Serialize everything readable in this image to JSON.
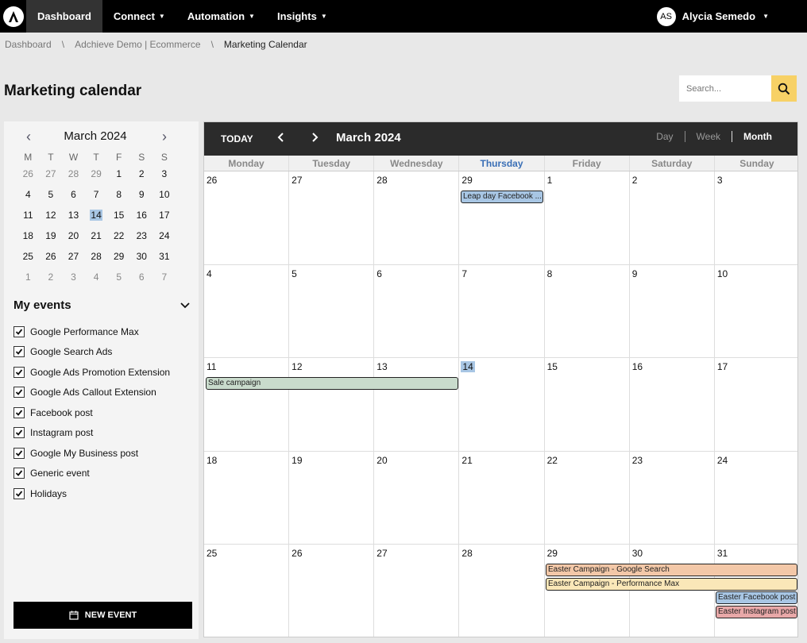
{
  "nav": {
    "items": [
      {
        "label": "Dashboard",
        "active": true,
        "caret": false
      },
      {
        "label": "Connect",
        "caret": true
      },
      {
        "label": "Automation",
        "caret": true
      },
      {
        "label": "Insights",
        "caret": true
      }
    ],
    "user": {
      "initials": "AS",
      "name": "Alycia Semedo"
    }
  },
  "breadcrumb": [
    "Dashboard",
    "Adchieve Demo | Ecommerce",
    "Marketing Calendar"
  ],
  "breadcrumb_sep": "\\",
  "page_title": "Marketing calendar",
  "search": {
    "placeholder": "Search..."
  },
  "mini_calendar": {
    "title": "March 2024",
    "dows": [
      "M",
      "T",
      "W",
      "T",
      "F",
      "S",
      "S"
    ],
    "weeks": [
      [
        {
          "d": "26",
          "o": true
        },
        {
          "d": "27",
          "o": true
        },
        {
          "d": "28",
          "o": true
        },
        {
          "d": "29",
          "o": true
        },
        {
          "d": "1"
        },
        {
          "d": "2"
        },
        {
          "d": "3"
        }
      ],
      [
        {
          "d": "4"
        },
        {
          "d": "5"
        },
        {
          "d": "6"
        },
        {
          "d": "7"
        },
        {
          "d": "8"
        },
        {
          "d": "9"
        },
        {
          "d": "10"
        }
      ],
      [
        {
          "d": "11"
        },
        {
          "d": "12"
        },
        {
          "d": "13"
        },
        {
          "d": "14",
          "t": true
        },
        {
          "d": "15"
        },
        {
          "d": "16"
        },
        {
          "d": "17"
        }
      ],
      [
        {
          "d": "18"
        },
        {
          "d": "19"
        },
        {
          "d": "20"
        },
        {
          "d": "21"
        },
        {
          "d": "22"
        },
        {
          "d": "23"
        },
        {
          "d": "24"
        }
      ],
      [
        {
          "d": "25"
        },
        {
          "d": "26"
        },
        {
          "d": "27"
        },
        {
          "d": "28"
        },
        {
          "d": "29"
        },
        {
          "d": "30"
        },
        {
          "d": "31"
        }
      ],
      [
        {
          "d": "1",
          "o": true
        },
        {
          "d": "2",
          "o": true
        },
        {
          "d": "3",
          "o": true
        },
        {
          "d": "4",
          "o": true
        },
        {
          "d": "5",
          "o": true
        },
        {
          "d": "6",
          "o": true
        },
        {
          "d": "7",
          "o": true
        }
      ]
    ]
  },
  "my_events": {
    "title": "My events",
    "items": [
      {
        "label": "Google Performance Max",
        "checked": true
      },
      {
        "label": "Google Search Ads",
        "checked": true
      },
      {
        "label": "Google Ads Promotion Extension",
        "checked": true
      },
      {
        "label": "Google Ads Callout Extension",
        "checked": true
      },
      {
        "label": "Facebook post",
        "checked": true
      },
      {
        "label": "Instagram post",
        "checked": true
      },
      {
        "label": "Google My Business post",
        "checked": true
      },
      {
        "label": "Generic event",
        "checked": true
      },
      {
        "label": "Holidays",
        "checked": true
      }
    ]
  },
  "new_event_label": "NEW EVENT",
  "calendar": {
    "today_label": "TODAY",
    "title": "March 2024",
    "views": [
      {
        "label": "Day"
      },
      {
        "label": "Week"
      },
      {
        "label": "Month",
        "active": true
      }
    ],
    "dows": [
      "Monday",
      "Tuesday",
      "Wednesday",
      "Thursday",
      "Friday",
      "Saturday",
      "Sunday"
    ],
    "current_dow": 3,
    "weeks": [
      [
        "26",
        "27",
        "28",
        "29",
        "1",
        "2",
        "3"
      ],
      [
        "4",
        "5",
        "6",
        "7",
        "8",
        "9",
        "10"
      ],
      [
        "11",
        "12",
        "13",
        "14",
        "15",
        "16",
        "17"
      ],
      [
        "18",
        "19",
        "20",
        "21",
        "22",
        "23",
        "24"
      ],
      [
        "25",
        "26",
        "27",
        "28",
        "29",
        "30",
        "31"
      ]
    ],
    "today": {
      "week": 2,
      "day": 3
    },
    "events": [
      {
        "label": "Leap day Facebook ...",
        "week": 0,
        "start": 3,
        "span": 1,
        "slot": 0,
        "color": "#a8c6e4"
      },
      {
        "label": "Sale campaign",
        "week": 2,
        "start": 0,
        "span": 3,
        "slot": 0,
        "color": "#c9dbcc"
      },
      {
        "label": "Easter Campaign - Google Search",
        "week": 4,
        "start": 4,
        "span": 3,
        "slot": 0,
        "color": "#f3c8a8"
      },
      {
        "label": "Easter Campaign - Performance Max",
        "week": 4,
        "start": 4,
        "span": 3,
        "slot": 1,
        "color": "#fae7b8"
      },
      {
        "label": "Easter Facebook post",
        "week": 4,
        "start": 6,
        "span": 1,
        "slot": 2,
        "color": "#a8c6e4"
      },
      {
        "label": "Easter Instagram post",
        "week": 4,
        "start": 6,
        "span": 1,
        "slot": 3,
        "color": "#e8a8a8"
      }
    ]
  }
}
